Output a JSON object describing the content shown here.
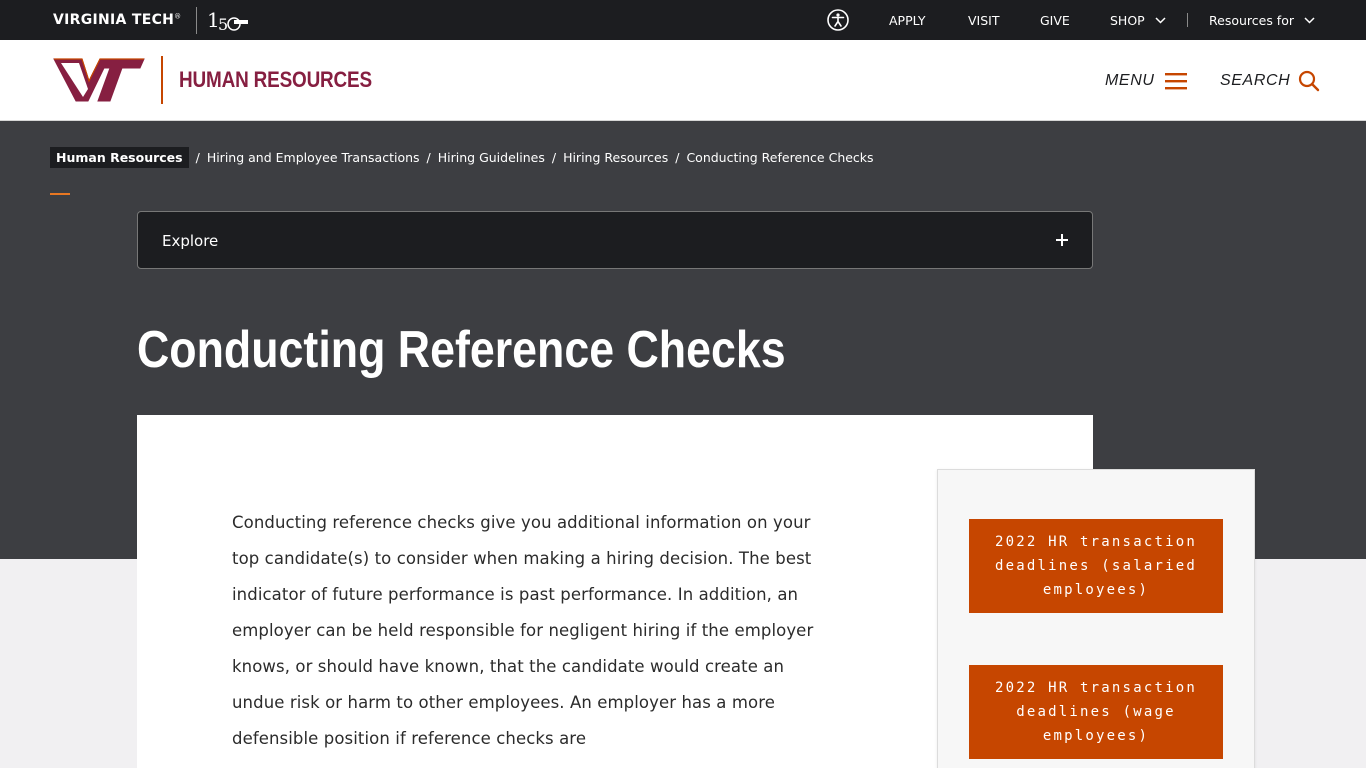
{
  "topbar": {
    "brand": "VIRGINIA TECH",
    "brand_mark": "®",
    "links": {
      "apply": "APPLY",
      "visit": "VISIT",
      "give": "GIVE",
      "shop": "SHOP",
      "resources": "Resources for"
    }
  },
  "header": {
    "site_name": "HUMAN RESOURCES",
    "menu_label": "MENU",
    "search_label": "SEARCH"
  },
  "breadcrumb": [
    "Human Resources",
    "Hiring and Employee Transactions",
    "Hiring Guidelines",
    "Hiring Resources",
    "Conducting Reference Checks"
  ],
  "explore": {
    "label": "Explore"
  },
  "page": {
    "title": "Conducting Reference Checks",
    "body": "Conducting reference checks give you additional information on your top candidate(s) to consider when making a hiring decision. The best indicator of future performance is past performance. In addition, an employer can be held responsible for negligent hiring if the employer knows, or should have known, that the candidate would create an undue risk or harm to other employees. An employer has a more defensible position if reference checks are"
  },
  "sidebar": {
    "buttons": [
      "2022 HR transaction deadlines (salaried employees)",
      "2022 HR transaction deadlines (wage employees)"
    ]
  },
  "colors": {
    "maroon": "#861f41",
    "burnt_orange": "#c64600",
    "dark": "#1c1d20",
    "hero": "#3d3e42"
  }
}
